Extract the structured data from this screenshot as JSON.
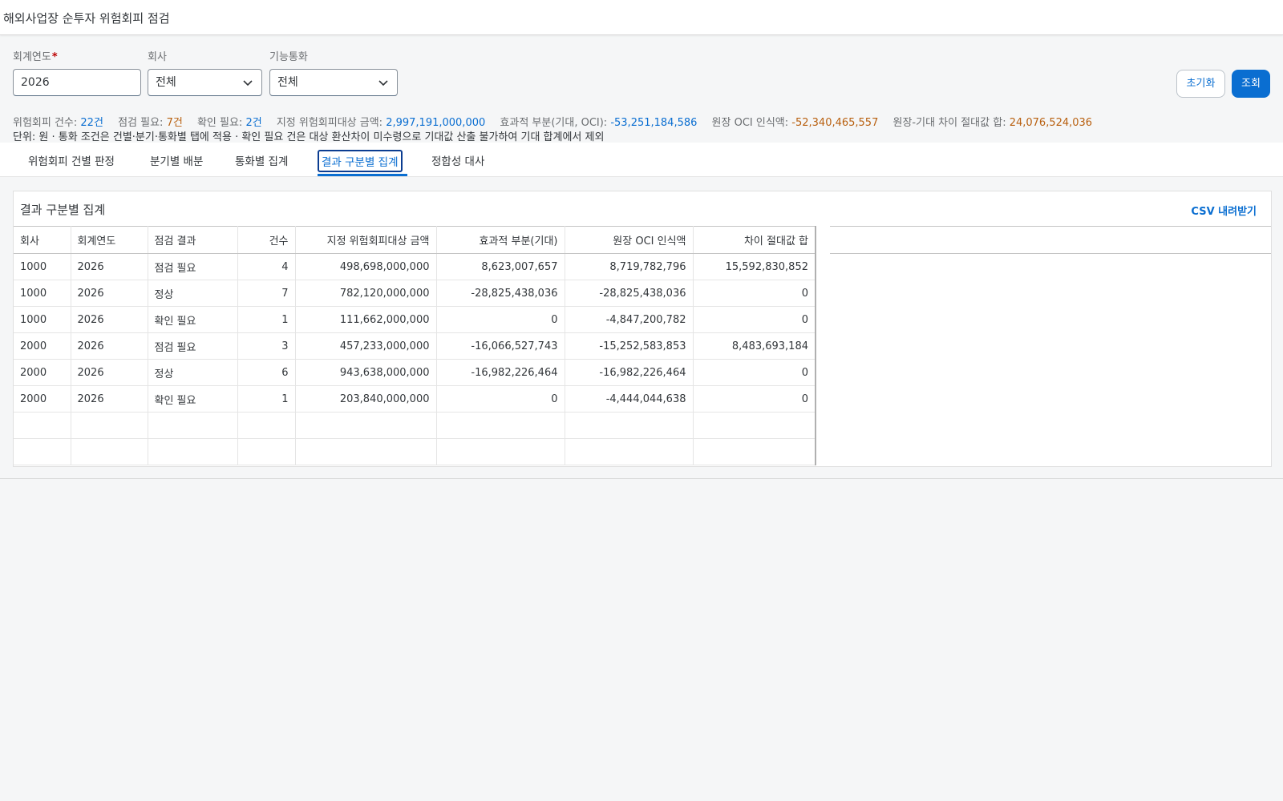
{
  "app": {
    "title": "해외사업장 순투자 위험회피 점검"
  },
  "filters": {
    "year": {
      "label": "회계연도",
      "required_mark": "*",
      "value": "2026"
    },
    "company": {
      "label": "회사",
      "value": "전체"
    },
    "currency": {
      "label": "기능통화",
      "value": "전체"
    }
  },
  "actions": {
    "reset_label": "초기화",
    "search_label": "조회"
  },
  "summary": {
    "items": [
      {
        "label": "위험회피 건수: ",
        "value": "22건",
        "tone": "blue"
      },
      {
        "label": "점검 필요: ",
        "value": "7건",
        "tone": "orange"
      },
      {
        "label": "확인 필요: ",
        "value": "2건",
        "tone": "blue"
      },
      {
        "label": "지정 위험회피대상 금액: ",
        "value": "2,997,191,000,000",
        "tone": "blue"
      },
      {
        "label": "효과적 부분(기대, OCI): ",
        "value": "-53,251,184,586",
        "tone": "blue"
      },
      {
        "label": "원장 OCI 인식액: ",
        "value": "-52,340,465,557",
        "tone": "orange"
      },
      {
        "label": "원장-기대 차이 절대값 합: ",
        "value": "24,076,524,036",
        "tone": "orange"
      }
    ],
    "note": "단위: 원 · 통화 조건은 건별·분기·통화별 탭에 적용 · 확인 필요 건은 대상 환산차이 미수령으로 기대값 산출 불가하여 기대 합계에서 제외"
  },
  "tabs": [
    {
      "label": "위험회피 건별 판정",
      "active": false
    },
    {
      "label": "분기별 배분",
      "active": false
    },
    {
      "label": "통화별 집계",
      "active": false
    },
    {
      "label": "결과 구분별 집계",
      "active": true
    },
    {
      "label": "정합성 대사",
      "active": false
    }
  ],
  "panel": {
    "title": "결과 구분별 집계",
    "csv_label": "CSV 내려받기"
  },
  "table": {
    "columns": [
      "회사",
      "회계연도",
      "점검 결과",
      "건수",
      "지정 위험회피대상 금액",
      "효과적 부분(기대)",
      "원장 OCI 인식액",
      "차이 절대값 합"
    ],
    "rows": [
      {
        "company": "1000",
        "year": "2026",
        "result": "점검 필요",
        "tone": "warn",
        "count": "4",
        "hedged": "498,698,000,000",
        "effective": "8,623,007,657",
        "oci": "8,719,782,796",
        "diff": "15,592,830,852"
      },
      {
        "company": "1000",
        "year": "2026",
        "result": "정상",
        "tone": "ok",
        "count": "7",
        "hedged": "782,120,000,000",
        "effective": "-28,825,438,036",
        "oci": "-28,825,438,036",
        "diff": "0"
      },
      {
        "company": "1000",
        "year": "2026",
        "result": "확인 필요",
        "tone": "info",
        "count": "1",
        "hedged": "111,662,000,000",
        "effective": "0",
        "oci": "-4,847,200,782",
        "diff": "0"
      },
      {
        "company": "2000",
        "year": "2026",
        "result": "점검 필요",
        "tone": "warn",
        "count": "3",
        "hedged": "457,233,000,000",
        "effective": "-16,066,527,743",
        "oci": "-15,252,583,853",
        "diff": "8,483,693,184"
      },
      {
        "company": "2000",
        "year": "2026",
        "result": "정상",
        "tone": "ok",
        "count": "6",
        "hedged": "943,638,000,000",
        "effective": "-16,982,226,464",
        "oci": "-16,982,226,464",
        "diff": "0"
      },
      {
        "company": "2000",
        "year": "2026",
        "result": "확인 필요",
        "tone": "info",
        "count": "1",
        "hedged": "203,840,000,000",
        "effective": "0",
        "oci": "-4,444,044,638",
        "diff": "0"
      }
    ]
  },
  "colors": {
    "accent": "#0a6ed1",
    "warn": "#b85f0e",
    "ok": "#2b7d2b",
    "required": "#bb0000"
  },
  "icons": {
    "dropdown": "chevron-down-icon"
  }
}
